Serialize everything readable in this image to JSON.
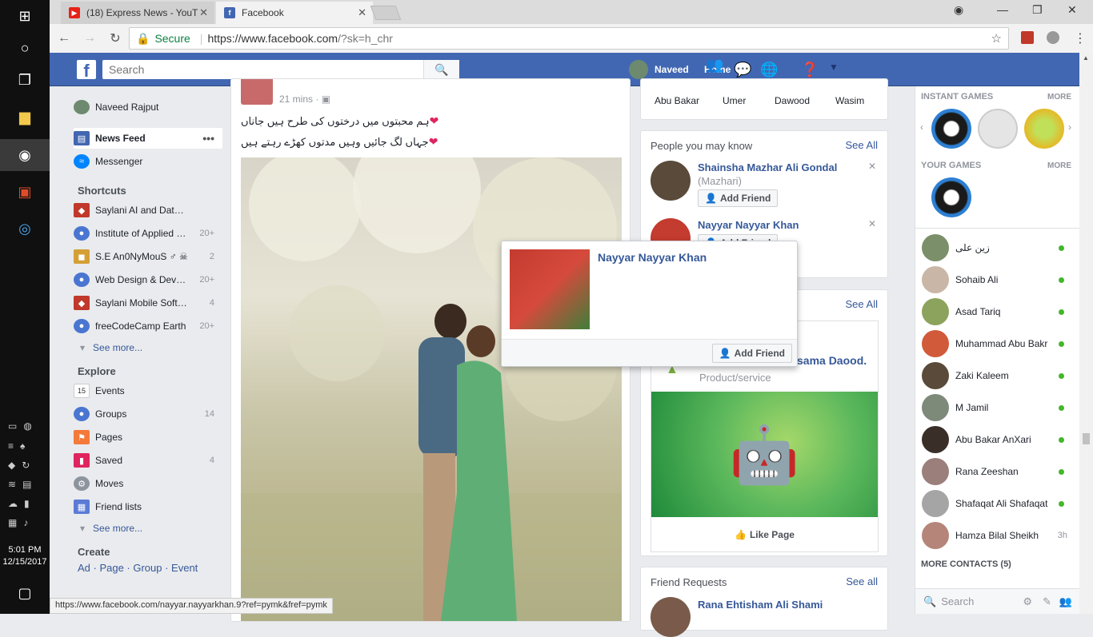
{
  "windows_taskbar": {
    "clock_time": "5:01 PM",
    "clock_date": "12/15/2017"
  },
  "browser": {
    "tabs": [
      {
        "title": "(18) Express News - YouT",
        "favicon": "youtube-icon"
      },
      {
        "title": "Facebook",
        "favicon": "facebook-icon"
      }
    ],
    "secure_label": "Secure",
    "url_host": "https://www.facebook.com",
    "url_path": "/?sk=h_chr",
    "status_url": "https://www.facebook.com/nayyar.nayyarkhan.9?ref=pymk&fref=pymk"
  },
  "fb_header": {
    "logo": "f",
    "search_placeholder": "Search",
    "user_name": "Naveed",
    "home_label": "Home"
  },
  "left_nav": {
    "profile": "Naveed Rajput",
    "news_feed": "News Feed",
    "messenger": "Messenger",
    "shortcuts_title": "Shortcuts",
    "shortcuts": [
      {
        "label": "Saylani AI and Dat…",
        "count": ""
      },
      {
        "label": "Institute of Applied …",
        "count": "20+"
      },
      {
        "label": "S.E An0NyMouS ♂ ☠",
        "count": "2"
      },
      {
        "label": "Web Design & Dev…",
        "count": "20+"
      },
      {
        "label": "Saylani Mobile Soft…",
        "count": "4"
      },
      {
        "label": "freeCodeCamp Earth",
        "count": "20+"
      }
    ],
    "see_more": "See more...",
    "explore_title": "Explore",
    "explore": [
      {
        "label": "Events",
        "count": ""
      },
      {
        "label": "Groups",
        "count": "14"
      },
      {
        "label": "Pages",
        "count": ""
      },
      {
        "label": "Saved",
        "count": "4"
      },
      {
        "label": "Moves",
        "count": ""
      },
      {
        "label": "Friend lists",
        "count": ""
      }
    ],
    "see_more_2": "See more...",
    "create_title": "Create",
    "create_links": "Ad · Page · Group · Event"
  },
  "post": {
    "time": "21 mins",
    "line1": "ہم محبتوں میں درختوں کی طرح ہیں جاناں",
    "line2": "جہاں لگ جائیں وہیں مدتوں کھڑے رہتے ہیں"
  },
  "stories": {
    "names": [
      "Abu Bakar",
      "Umer",
      "Dawood",
      "Wasim"
    ]
  },
  "pymk": {
    "title": "People you may know",
    "see_all": "See All",
    "people": [
      {
        "name": "Shainsha Mazhar Ali Gondal",
        "alt": "(Mazhari)",
        "button": "Add Friend"
      },
      {
        "name": "Nayyar Nayyar Khan",
        "alt": "",
        "button": "Add Friend"
      }
    ]
  },
  "page_suggest": {
    "see_all": "See All",
    "page_name": "sama Daood.",
    "category": "Product/service",
    "like_label": "Like Page"
  },
  "friend_requests": {
    "title": "Friend Requests",
    "see_all": "See all",
    "first_name": "Rana Ehtisham Ali Shami"
  },
  "hover_card": {
    "name": "Nayyar Nayyar Khan",
    "button": "Add Friend"
  },
  "chat_sidebar": {
    "instant_games": "INSTANT GAMES",
    "your_games": "YOUR GAMES",
    "more": "MORE",
    "contacts": [
      {
        "name": "زین علی",
        "status": "online",
        "ago": ""
      },
      {
        "name": "Sohaib Ali",
        "status": "online",
        "ago": ""
      },
      {
        "name": "Asad Tariq",
        "status": "online",
        "ago": ""
      },
      {
        "name": "Muhammad Abu Bakr",
        "status": "online",
        "ago": ""
      },
      {
        "name": "Zaki Kaleem",
        "status": "online",
        "ago": ""
      },
      {
        "name": "M Jamil",
        "status": "online",
        "ago": ""
      },
      {
        "name": "Abu Bakar AnXari",
        "status": "online",
        "ago": ""
      },
      {
        "name": "Rana Zeeshan",
        "status": "online",
        "ago": ""
      },
      {
        "name": "Shafaqat Ali Shafaqat",
        "status": "online",
        "ago": ""
      },
      {
        "name": "Hamza Bilal Sheikh",
        "status": "away",
        "ago": "3h"
      }
    ],
    "more_contacts": "MORE CONTACTS (5)",
    "search_placeholder": "Search"
  },
  "colors": {
    "fb_blue": "#4267b2",
    "link_blue": "#365899",
    "online_green": "#42b72a"
  }
}
